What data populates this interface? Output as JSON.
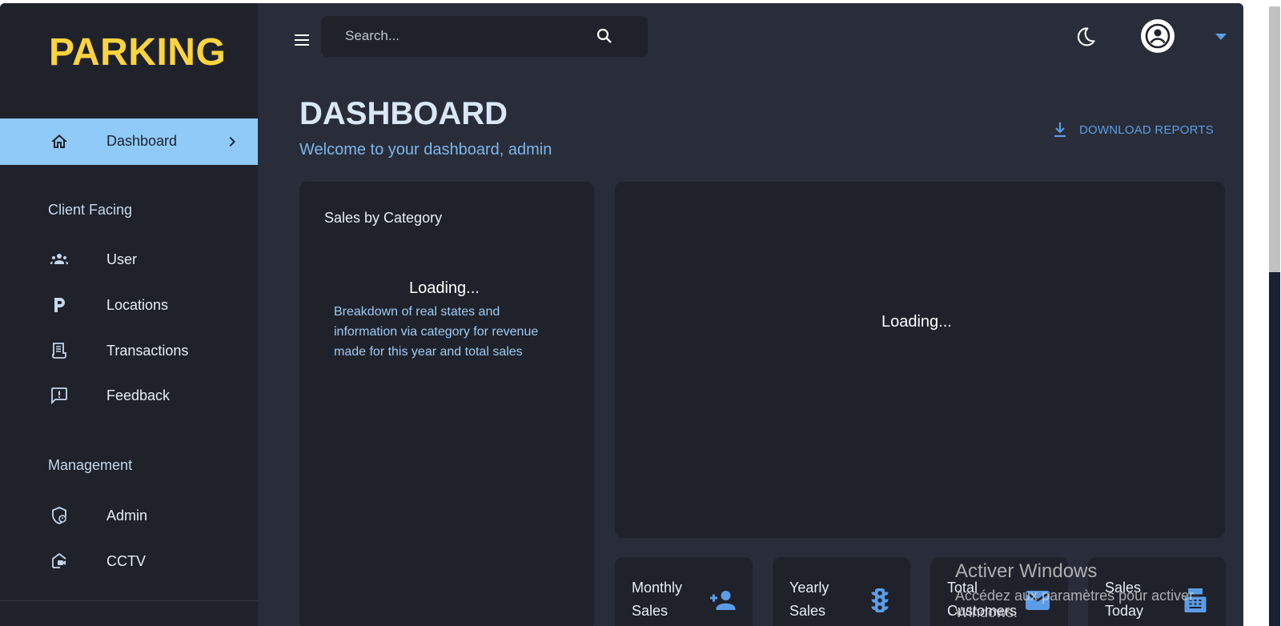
{
  "brand": {
    "name": "PARKING",
    "color": "#fdd440"
  },
  "colors": {
    "accent": "#90caf9",
    "background": "#292d39",
    "panel": "#1f222b",
    "link": "#5c9ce6"
  },
  "sidebar": {
    "active_item": {
      "label": "Dashboard",
      "icon": "home-icon"
    },
    "sections": [
      {
        "title": "Client Facing",
        "items": [
          {
            "label": "User",
            "icon": "groups-icon"
          },
          {
            "label": "Locations",
            "icon": "parking-icon"
          },
          {
            "label": "Transactions",
            "icon": "receipt-icon"
          },
          {
            "label": "Feedback",
            "icon": "feedback-icon"
          }
        ]
      },
      {
        "title": "Management",
        "items": [
          {
            "label": "Admin",
            "icon": "admin-shield-icon"
          },
          {
            "label": "CCTV",
            "icon": "camera-home-icon"
          }
        ]
      }
    ]
  },
  "topbar": {
    "search_placeholder": "Search...",
    "icons": [
      "menu-icon",
      "search-icon",
      "dark-mode-icon",
      "account-icon",
      "caret-down-icon"
    ]
  },
  "header": {
    "title": "DASHBOARD",
    "subtitle": "Welcome to your dashboard, admin",
    "download_label": "DOWNLOAD REPORTS"
  },
  "sales_by_category": {
    "title": "Sales by Category",
    "loading": "Loading...",
    "description": "Breakdown of real states and information via category for revenue made for this year and total sales"
  },
  "main_panel": {
    "loading": "Loading..."
  },
  "stats": [
    {
      "label": "Monthly Sales",
      "icon": "person-add-icon"
    },
    {
      "label": "Yearly Sales",
      "icon": "traffic-icon"
    },
    {
      "label": "Total Customers",
      "icon": "email-icon"
    },
    {
      "label": "Sales Today",
      "icon": "point-of-sale-icon"
    }
  ],
  "watermark": {
    "title": "Activer Windows",
    "subtitle": "Accédez aux paramètres pour activer Windows."
  }
}
